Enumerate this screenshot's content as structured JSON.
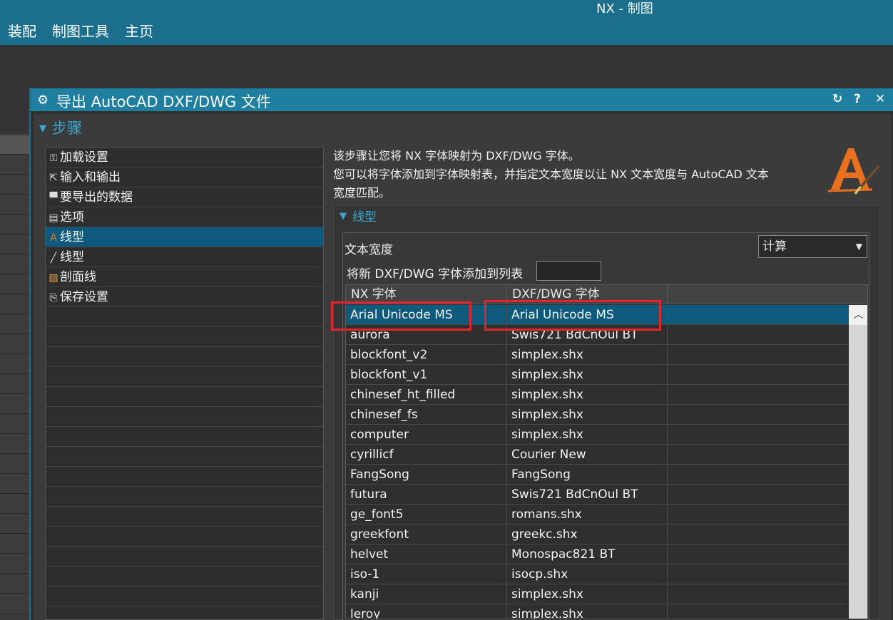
{
  "app": {
    "title": "NX - 制图"
  },
  "ribbon": {
    "tabs": [
      "装配",
      "制图工具",
      "主页"
    ]
  },
  "dialog": {
    "title": "导出 AutoCAD DXF/DWG 文件",
    "controls": {
      "reset": "↻",
      "help": "?",
      "close": "✕"
    },
    "section": "步骤",
    "steps": [
      {
        "label": "加载设置",
        "icon": "wrench-icon",
        "glyph": "⚿"
      },
      {
        "label": "输入和输出",
        "icon": "export-icon",
        "glyph": "⇱"
      },
      {
        "label": "要导出的数据",
        "icon": "data-icon",
        "glyph": "▀"
      },
      {
        "label": "选项",
        "icon": "options-icon",
        "glyph": "▤"
      },
      {
        "label": "线型",
        "icon": "font-icon",
        "glyph": "A"
      },
      {
        "label": "线型",
        "icon": "line-icon",
        "glyph": "╱"
      },
      {
        "label": "剖面线",
        "icon": "hatch-icon",
        "glyph": "▨"
      },
      {
        "label": "保存设置",
        "icon": "save-settings-icon",
        "glyph": "⎘"
      }
    ],
    "selected_step": 4,
    "description": [
      "该步骤让您将 NX 字体映射为 DXF/DWG 字体。",
      "您可以将字体添加到字体映射表，并指定文本宽度以让 NX 文本宽度与 AutoCAD 文本",
      "宽度匹配。"
    ],
    "subsection": "线型",
    "text_width_label": "文本宽度",
    "text_width_value": "计算",
    "add_font_label": "将新 DXF/DWG 字体添加到列表",
    "add_font_value": "",
    "table": {
      "columns": [
        "NX 字体",
        "DXF/DWG 字体"
      ],
      "rows": [
        [
          "Arial Unicode MS",
          "Arial Unicode MS"
        ],
        [
          "aurora",
          "Swis721 BdCnOul BT"
        ],
        [
          "blockfont_v2",
          "simplex.shx"
        ],
        [
          "blockfont_v1",
          "simplex.shx"
        ],
        [
          "chinesef_ht_filled",
          "simplex.shx"
        ],
        [
          "chinesef_fs",
          "simplex.shx"
        ],
        [
          "computer",
          "simplex.shx"
        ],
        [
          "cyrillicf",
          "Courier New"
        ],
        [
          "FangSong",
          "FangSong"
        ],
        [
          "futura",
          "Swis721 BdCnOul BT"
        ],
        [
          "ge_font5",
          "romans.shx"
        ],
        [
          "greekfont",
          "greekc.shx"
        ],
        [
          "helvet",
          "Monospac821 BT"
        ],
        [
          "iso-1",
          "isocp.shx"
        ],
        [
          "kanji",
          "simplex.shx"
        ],
        [
          "leroy",
          "simplex.shx"
        ]
      ],
      "selected_row": 0
    }
  },
  "colors": {
    "accent": "#1f7fa1",
    "selection": "#0d5a7c",
    "highlight_box": "#e3242b"
  }
}
